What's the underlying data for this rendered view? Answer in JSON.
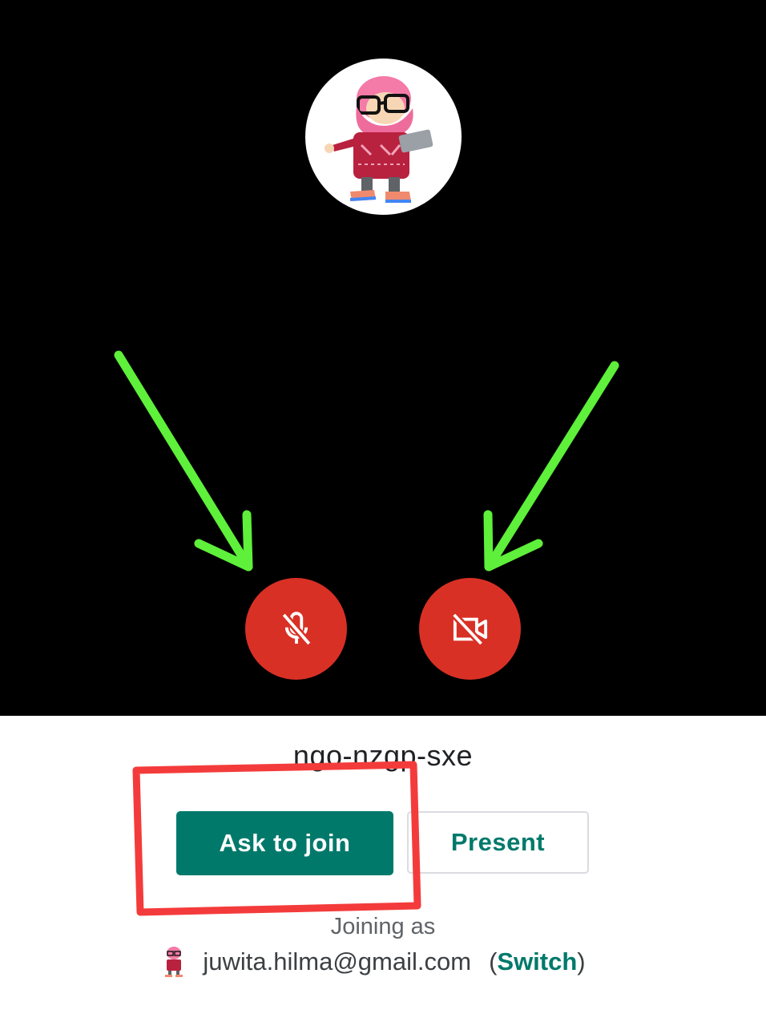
{
  "meeting": {
    "code": "ngo-nzgp-sxe"
  },
  "actions": {
    "ask_to_join": "Ask to join",
    "present": "Present"
  },
  "joining": {
    "label": "Joining as",
    "email": "juwita.hilma@gmail.com",
    "paren_open": "(",
    "switch": "Switch",
    "paren_close": ")"
  },
  "controls": {
    "mic_state": "muted",
    "camera_state": "off"
  },
  "icons": {
    "profile": "profile-avatar-illustration",
    "mic": "mic-off-icon",
    "camera": "videocam-off-icon",
    "account": "account-avatar-icon"
  },
  "colors": {
    "preview_bg": "#000000",
    "control_off_red": "#d93025",
    "primary_teal": "#00796b",
    "annotation_arrow": "#5ef03a",
    "annotation_box": "#f43b3b"
  }
}
